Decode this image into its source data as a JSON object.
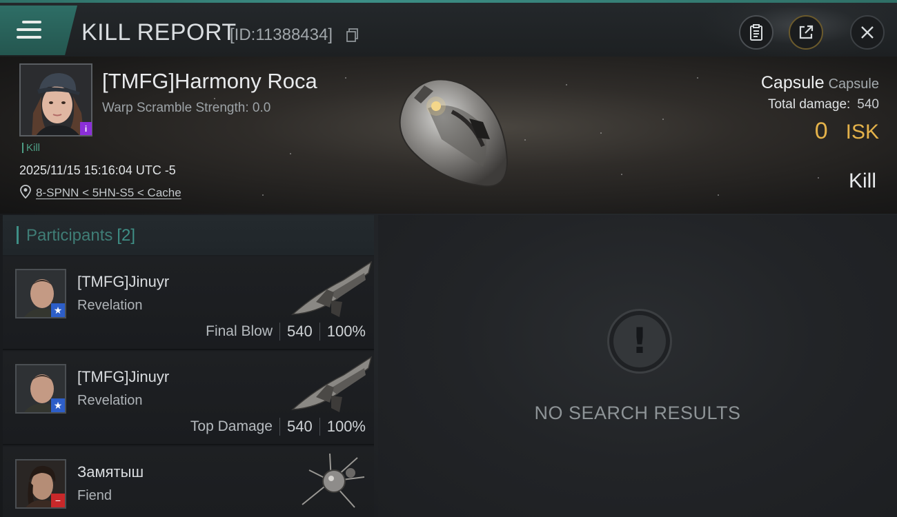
{
  "header": {
    "title": "KILL REPORT",
    "report_id": "[ID:11388434]",
    "menu_icon": "hamburger-menu-icon",
    "actions": [
      "clipboard-icon",
      "share-icon",
      "close-icon"
    ]
  },
  "victim": {
    "name": "[TMFG]Harmony Roca",
    "warp_scramble": "Warp Scramble Strength: 0.0",
    "kill_tag": "Kill",
    "datetime": "2025/11/15 15:16:04 UTC -5",
    "location": "8-SPNN < 5HN-S5 < Cache",
    "ship_name": "Capsule",
    "ship_class": "Capsule",
    "total_damage_label": "Total damage:",
    "total_damage": "540",
    "isk_value": "0",
    "isk_unit": "ISK",
    "result": "Kill",
    "portrait_badge": "i"
  },
  "participants": {
    "title": "Participants",
    "count": "[2]",
    "rows": [
      {
        "name": "[TMFG]Jinuyr",
        "ship": "Revelation",
        "tag": "Final Blow",
        "damage": "540",
        "percent": "100%",
        "badge": "★"
      },
      {
        "name": "[TMFG]Jinuyr",
        "ship": "Revelation",
        "tag": "Top Damage",
        "damage": "540",
        "percent": "100%",
        "badge": "★"
      },
      {
        "name": "Замятыш",
        "ship": "Fiend",
        "badge": "−"
      }
    ]
  },
  "results": {
    "empty_text": "NO SEARCH RESULTS",
    "icon": "exclamation-icon"
  },
  "colors": {
    "accent": "#3e8f86",
    "isk": "#e4b24a",
    "portrait_badge": "#8b2fd8",
    "ally_badge": "#2d5ec8",
    "hostile_badge": "#c8282a"
  }
}
